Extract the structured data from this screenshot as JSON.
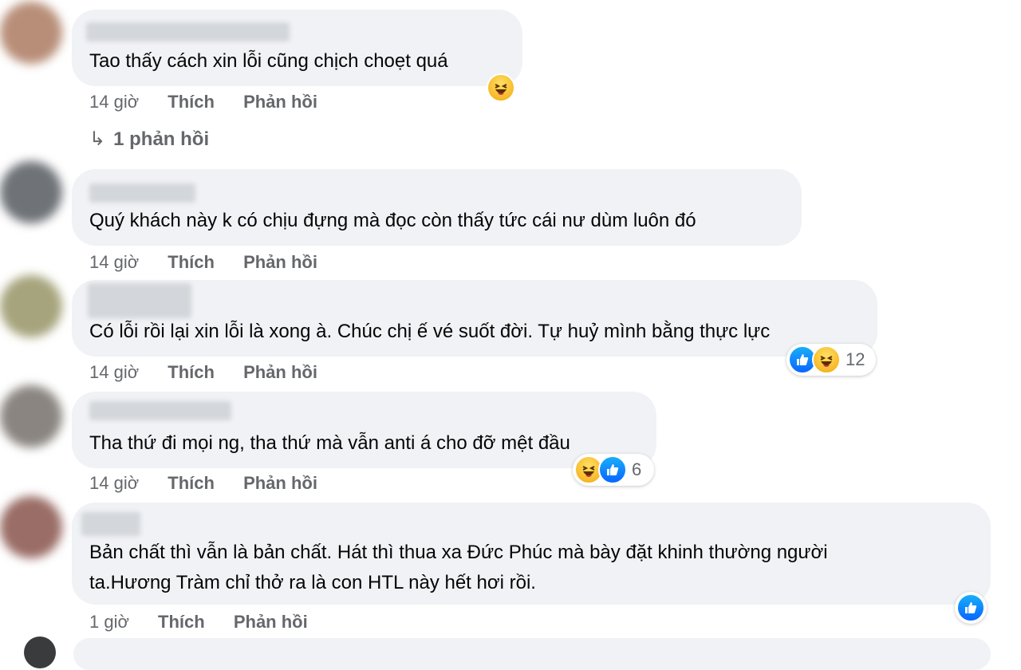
{
  "comments": [
    {
      "text_lines": [
        "Tao thấy cách xin lỗi cũng chịch choẹt quá"
      ],
      "time": "14 giờ",
      "like_label": "Thích",
      "reply_label": "Phản hồi",
      "reactions": [
        "haha-icon"
      ],
      "reaction_count": ""
    },
    {
      "text_lines": [
        "Quý khách này k có chịu đựng mà đọc còn thấy tức cái nư dùm luôn đó"
      ],
      "time": "14 giờ",
      "like_label": "Thích",
      "reply_label": "Phản hồi",
      "reactions": [],
      "reaction_count": ""
    },
    {
      "text_lines": [
        "Có lỗi rồi lại xin lỗi là xong à. Chúc chị ế vé suốt đời. Tự huỷ mình bằng thực lực"
      ],
      "time": "14 giờ",
      "like_label": "Thích",
      "reply_label": "Phản hồi",
      "reactions": [
        "like-icon",
        "haha-icon"
      ],
      "reaction_count": "12"
    },
    {
      "text_lines": [
        "Tha thứ đi mọi ng, tha thứ mà vẫn anti á cho đỡ mệt đầu"
      ],
      "time": "14 giờ",
      "like_label": "Thích",
      "reply_label": "Phản hồi",
      "reactions": [
        "haha-icon",
        "like-icon"
      ],
      "reaction_count": "6"
    },
    {
      "text_lines": [
        "Bản chất thì vẫn là bản chất. Hát thì thua xa Đức Phúc mà bày đặt khinh thường người",
        "ta.Hương Tràm chỉ thở ra là con HTL này hết hơi rồi."
      ],
      "time": "1 giờ",
      "like_label": "Thích",
      "reply_label": "Phản hồi",
      "reactions": [
        "like-icon"
      ],
      "reaction_count": ""
    }
  ],
  "view_replies": {
    "arrow": "↳",
    "label": "1 phản hồi"
  },
  "colors": {
    "bubble": "#f0f2f5",
    "meta_text": "#65676b",
    "like_blue": "#0866ff",
    "haha_yellow": "#f7b928"
  }
}
